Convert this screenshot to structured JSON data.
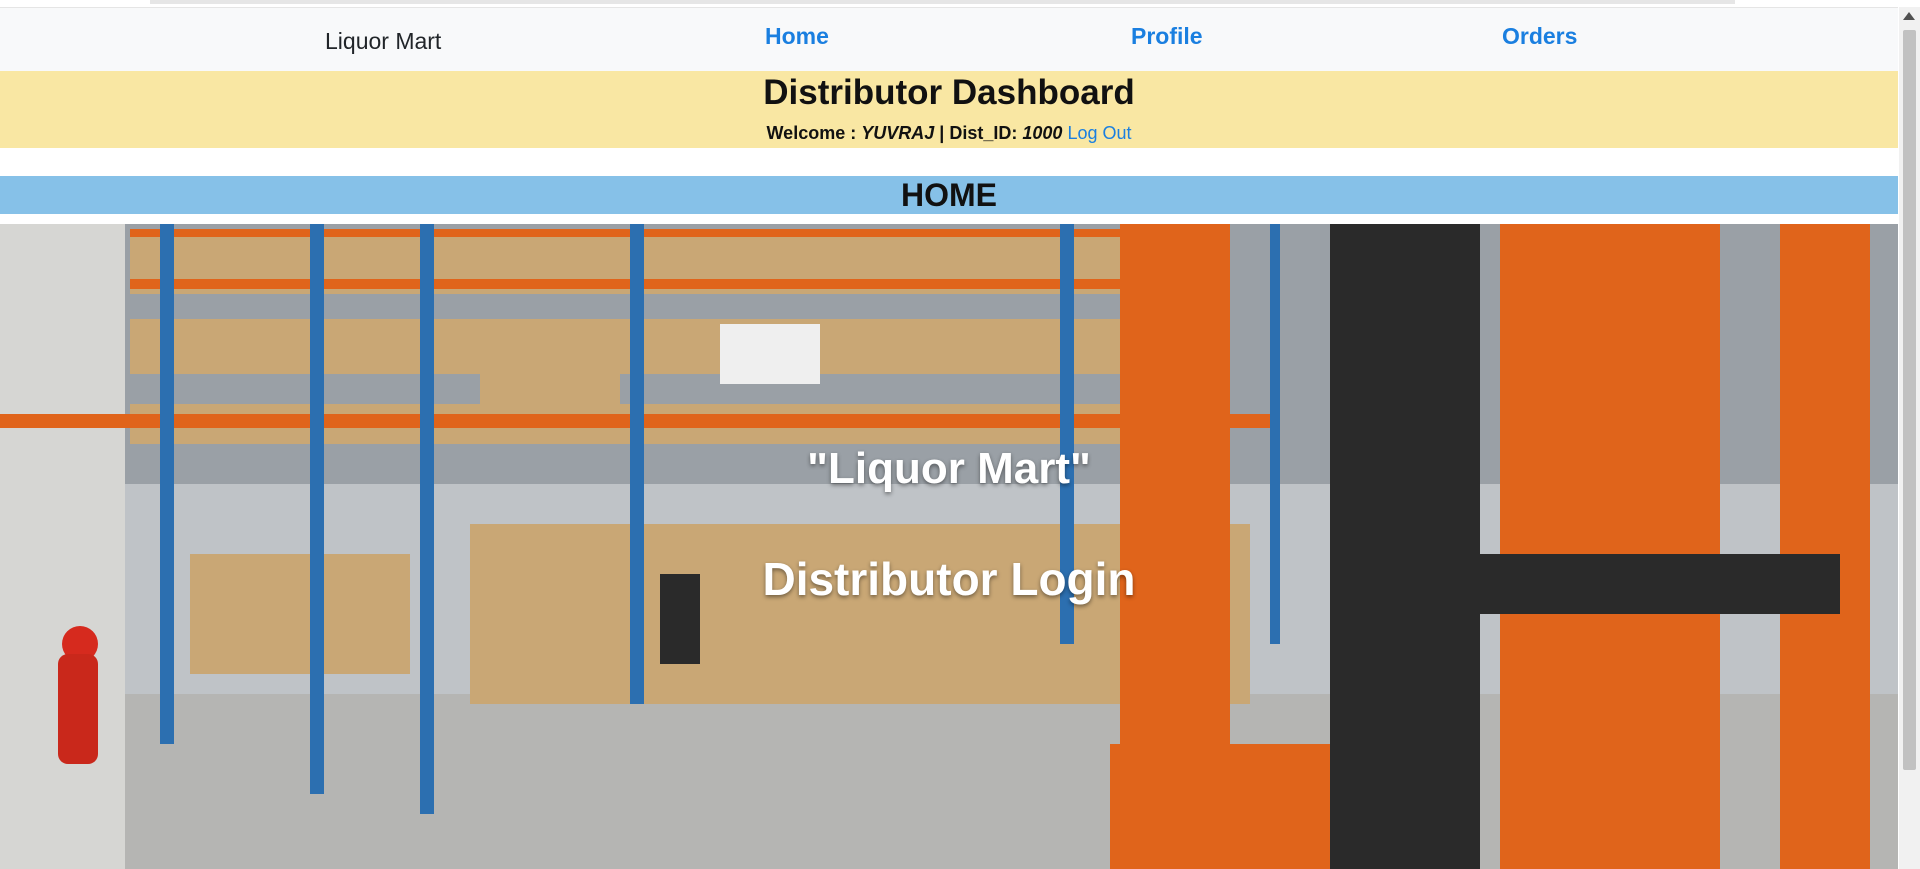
{
  "navbar": {
    "brand": "Liquor Mart",
    "links": [
      "Home",
      "Profile",
      "Orders"
    ]
  },
  "dashboard": {
    "title": "Distributor Dashboard",
    "welcome_label": "Welcome :",
    "user_name": "YUVRAJ",
    "separator": "|",
    "dist_id_label": "Dist_ID:",
    "dist_id": "1000",
    "logout_label": "Log Out"
  },
  "section": {
    "title": "HOME"
  },
  "hero": {
    "line1": "\"Liquor Mart\"",
    "line2": "Distributor Login"
  },
  "colors": {
    "link": "#1a7fe0",
    "dashboard_bg": "#f9e7a3",
    "section_bg": "#86c1e8",
    "navbar_bg": "#f8f9fa"
  }
}
